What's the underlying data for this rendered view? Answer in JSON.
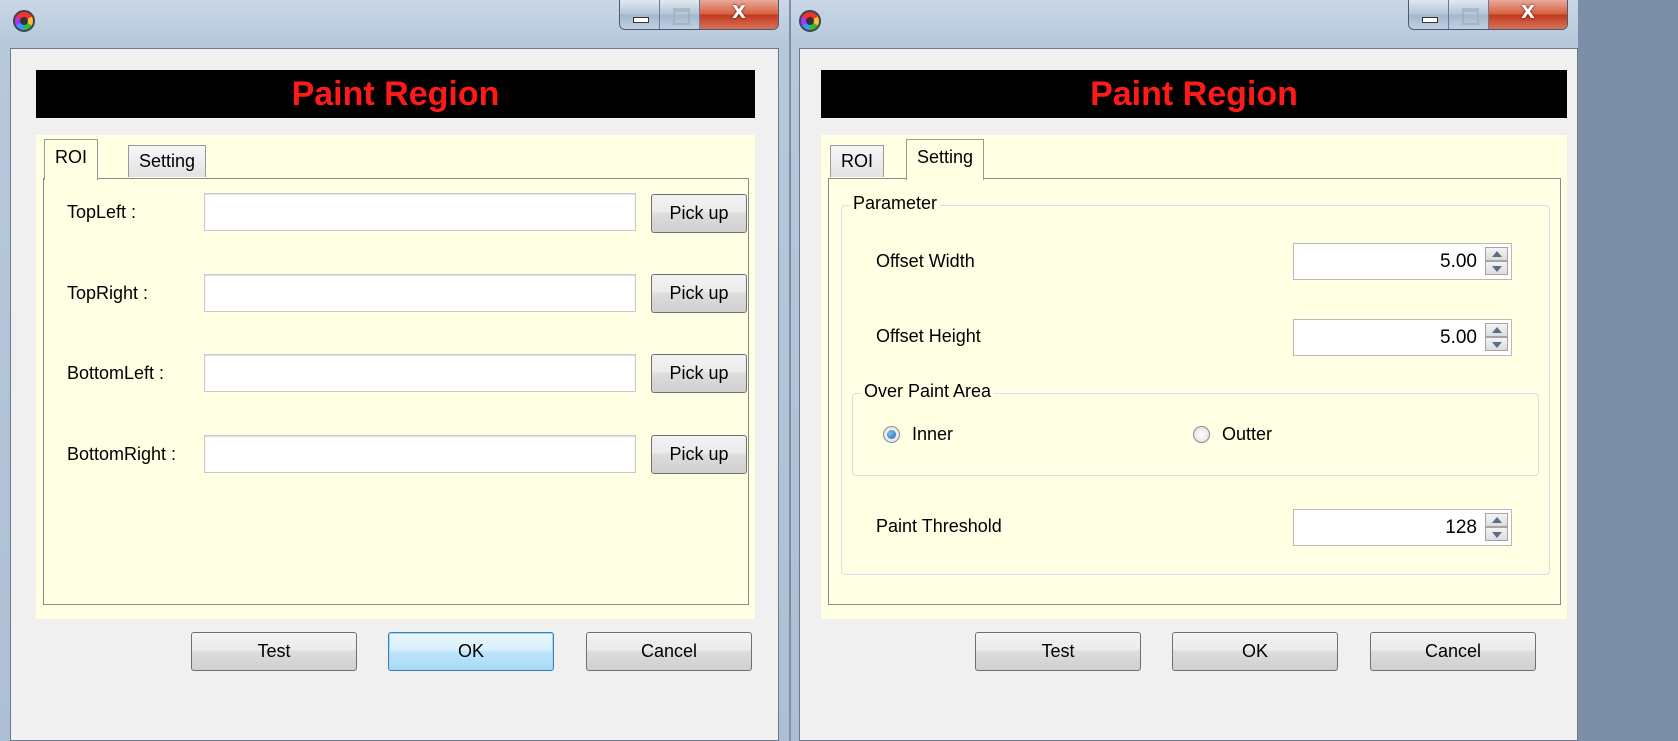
{
  "left_window": {
    "banner": "Paint Region",
    "close_glyph": "X",
    "tabs": [
      "ROI",
      "Setting"
    ],
    "active_tab": "ROI",
    "roi_rows": [
      {
        "label": "TopLeft :",
        "value": "",
        "button": "Pick up"
      },
      {
        "label": "TopRight :",
        "value": "",
        "button": "Pick up"
      },
      {
        "label": "BottomLeft :",
        "value": "",
        "button": "Pick up"
      },
      {
        "label": "BottomRight :",
        "value": "",
        "button": "Pick up"
      }
    ],
    "buttons": {
      "test": "Test",
      "ok": "OK",
      "cancel": "Cancel"
    }
  },
  "right_window": {
    "banner": "Paint Region",
    "close_glyph": "X",
    "tabs": [
      "ROI",
      "Setting"
    ],
    "active_tab": "Setting",
    "parameter_group": "Parameter",
    "offset_width_label": "Offset Width",
    "offset_width_value": "5.00",
    "offset_height_label": "Offset Height",
    "offset_height_value": "5.00",
    "over_paint_group": "Over Paint Area",
    "radio_inner": "Inner",
    "radio_outter": "Outter",
    "selected_radio": "Inner",
    "paint_threshold_label": "Paint Threshold",
    "paint_threshold_value": "128",
    "buttons": {
      "test": "Test",
      "ok": "OK",
      "cancel": "Cancel"
    }
  },
  "icons": [
    "app-icon",
    "minimize-icon",
    "maximize-icon",
    "close-icon",
    "spin-up-icon",
    "spin-down-icon"
  ]
}
